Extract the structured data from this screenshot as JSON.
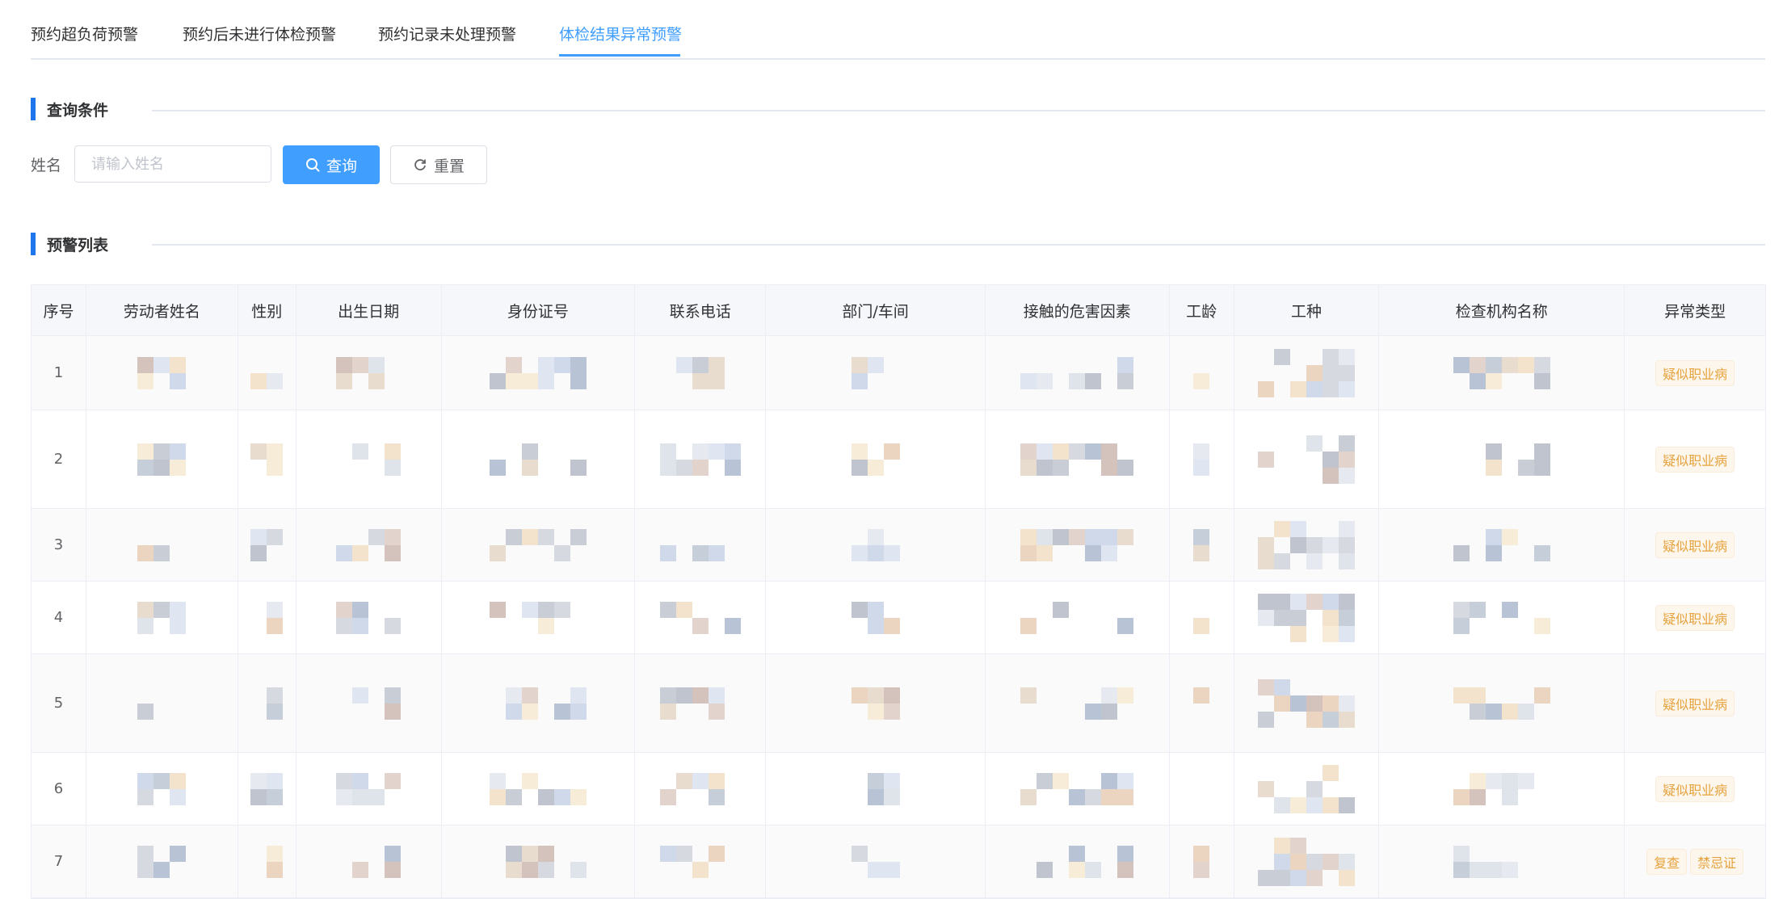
{
  "tabs": [
    {
      "label": "预约超负荷预警",
      "active": false
    },
    {
      "label": "预约后未进行体检预警",
      "active": false
    },
    {
      "label": "预约记录未处理预警",
      "active": false
    },
    {
      "label": "体检结果异常预警",
      "active": true
    }
  ],
  "query": {
    "section_title": "查询条件",
    "name_label": "姓名",
    "name_placeholder": "请输入姓名",
    "name_value": "",
    "search_label": "查询",
    "reset_label": "重置"
  },
  "list": {
    "section_title": "预警列表",
    "columns": [
      "序号",
      "劳动者姓名",
      "性别",
      "出生日期",
      "身份证号",
      "联系电话",
      "部门/车间",
      "接触的危害因素",
      "工龄",
      "工种",
      "检查机构名称",
      "异常类型"
    ],
    "rows": [
      {
        "index": "1",
        "tags": [
          "疑似职业病"
        ]
      },
      {
        "index": "2",
        "tags": [
          "疑似职业病"
        ]
      },
      {
        "index": "3",
        "tags": [
          "疑似职业病"
        ]
      },
      {
        "index": "4",
        "tags": [
          "疑似职业病"
        ]
      },
      {
        "index": "5",
        "tags": [
          "疑似职业病"
        ]
      },
      {
        "index": "6",
        "tags": [
          "疑似职业病"
        ]
      },
      {
        "index": "7",
        "tags": [
          "复查",
          "禁忌证"
        ]
      }
    ]
  },
  "colors": {
    "accent": "#409eff",
    "section_bar": "#1f75eb",
    "tag_text": "#e6a23c",
    "tag_bg": "#fdf6ec"
  },
  "icons": {
    "search": "search-icon",
    "reset": "refresh-icon"
  }
}
